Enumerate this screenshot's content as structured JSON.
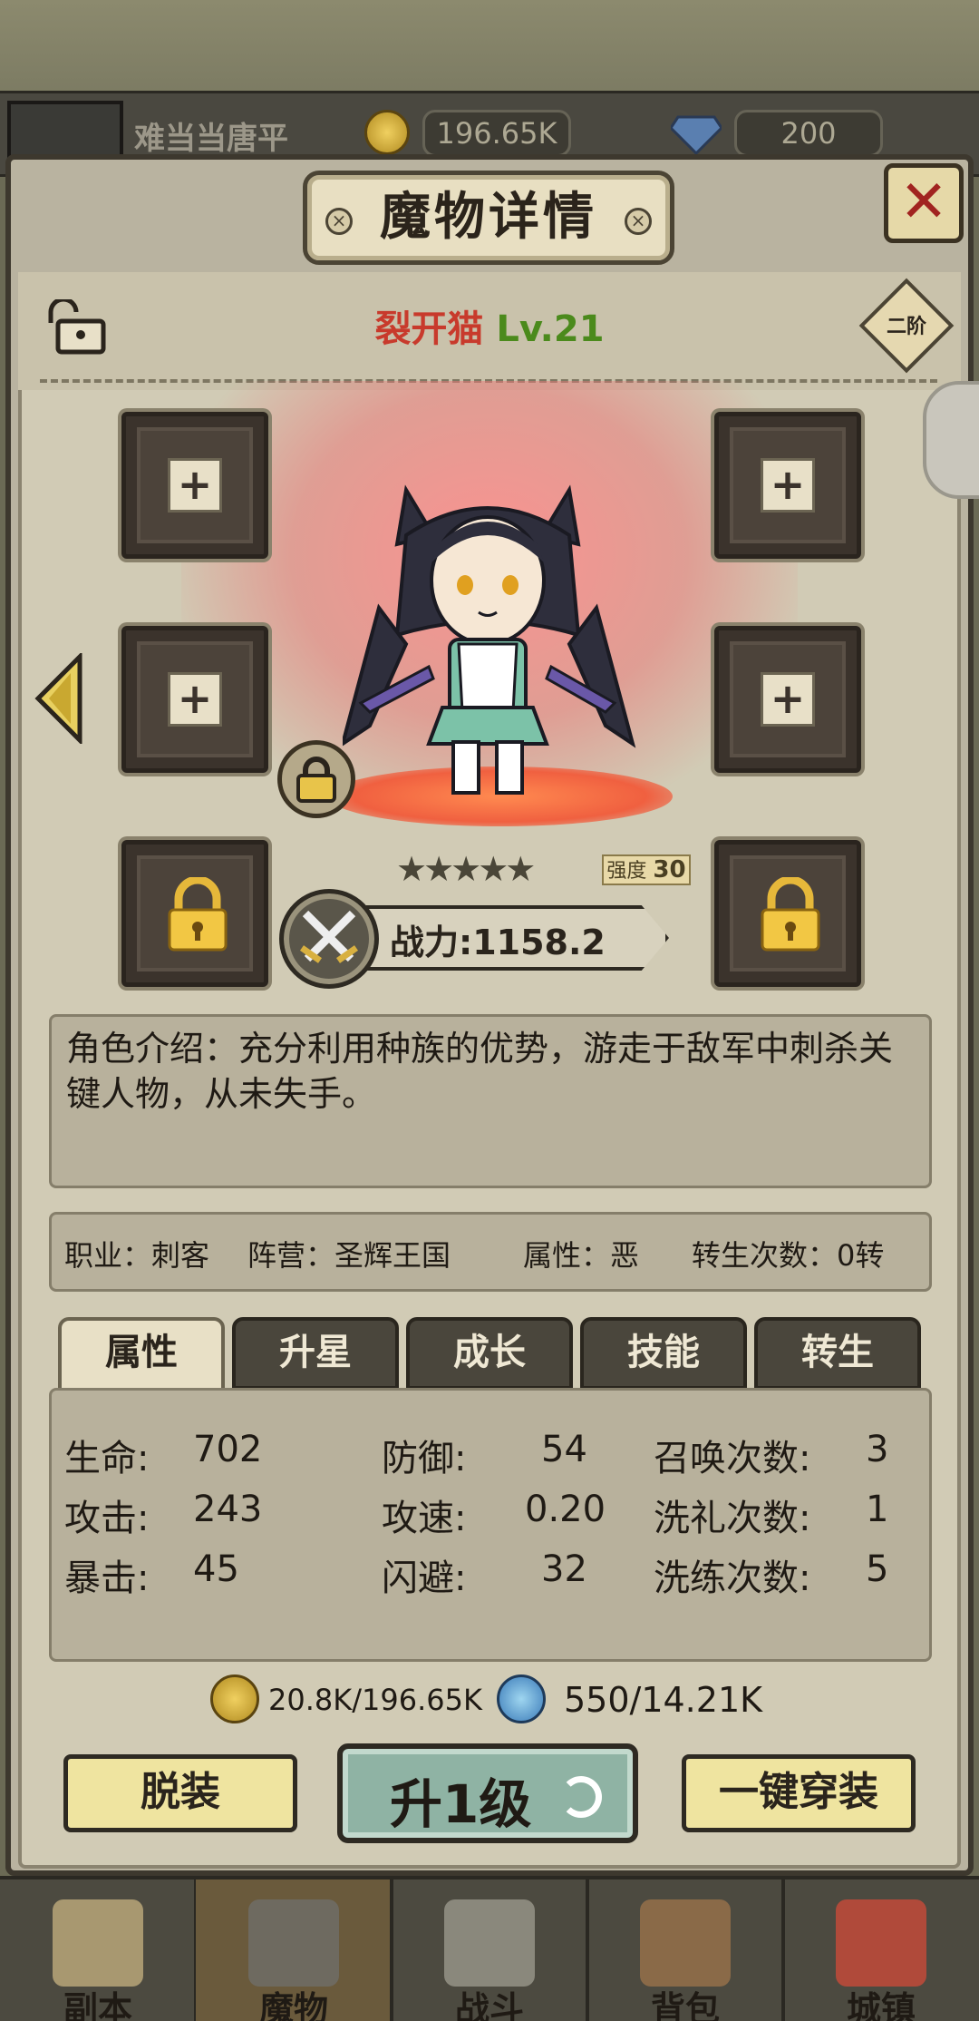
{
  "topbar": {
    "player_name": "难当当唐平",
    "gold": "196.65K",
    "gems": "200"
  },
  "dialog": {
    "title": "魔物详情",
    "close_label": "✕"
  },
  "monster": {
    "name": "裂开猫",
    "level": "Lv.21",
    "rank": "二阶",
    "strength_label": "强度",
    "strength": "30",
    "stars": "★★★★★",
    "power": "战力:1158.2",
    "description": "角色介绍：充分利用种族的优势，游走于敌军中刺杀关键人物，从未失手。"
  },
  "info": {
    "job": "职业：刺客",
    "camp": "阵营：圣辉王国",
    "attr": "属性：恶",
    "rebirth": "转生次数：0转"
  },
  "tabs": [
    "属性",
    "升星",
    "成长",
    "技能",
    "转生"
  ],
  "stats": {
    "hp_label": "生命:",
    "hp": "702",
    "atk_label": "攻击:",
    "atk": "243",
    "crit_label": "暴击:",
    "crit": "45",
    "def_label": "防御:",
    "def": "54",
    "spd_label": "攻速:",
    "spd": "0.20",
    "dodge_label": "闪避:",
    "dodge": "32",
    "summon_label": "召唤次数:",
    "summon": "3",
    "baptism_label": "洗礼次数:",
    "baptism": "1",
    "refine_label": "洗练次数:",
    "refine": "5"
  },
  "resources": {
    "gold": "20.8K/196.65K",
    "essence": "550/14.21K"
  },
  "buttons": {
    "unequip": "脱装",
    "levelup": "升1级",
    "equip_all": "一键穿装"
  },
  "nav": [
    "副本",
    "魔物",
    "战斗",
    "背包",
    "城镇"
  ],
  "colors": {
    "name_red": "#c83a2c",
    "level_green": "#4b8a1c",
    "close_red": "#a12420"
  }
}
